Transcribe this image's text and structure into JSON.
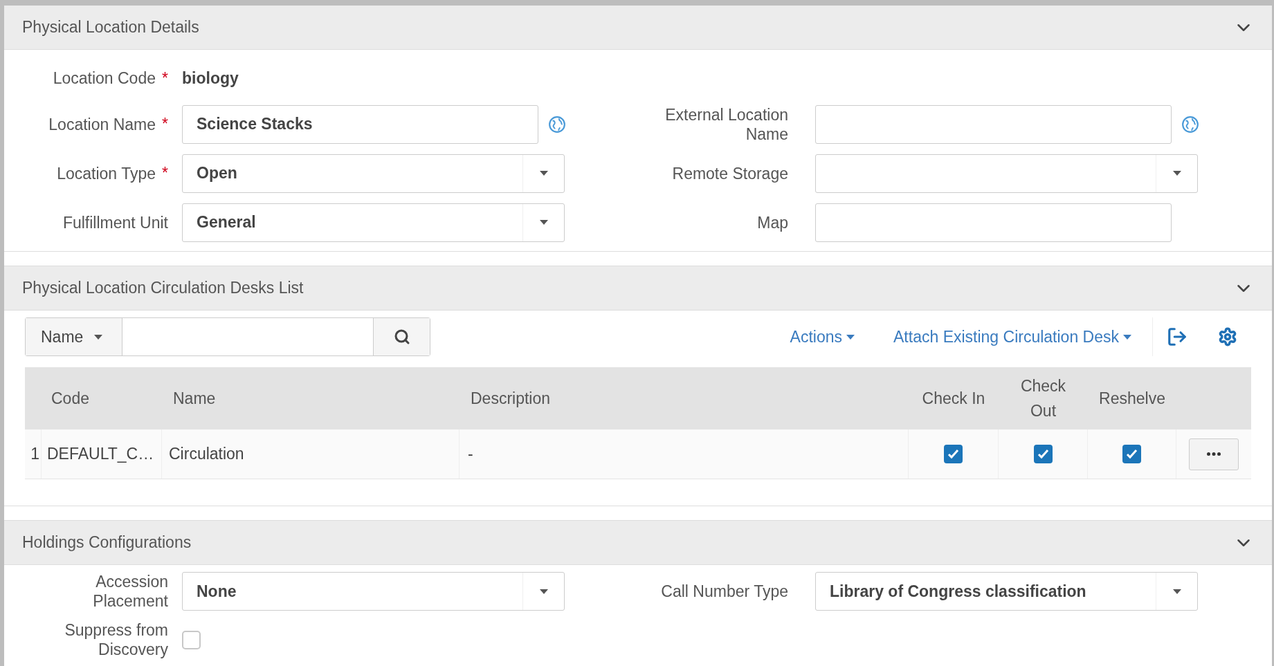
{
  "location_details": {
    "title": "Physical Location Details",
    "expanded": true,
    "rows": [
      {
        "left": {
          "label": "Location Code",
          "required_mark": "*",
          "kind": "static",
          "value": "biology"
        }
      },
      {
        "left": {
          "label": "Location Name",
          "required_mark": "*",
          "kind": "text",
          "value": "Science Stacks",
          "translatable": true
        },
        "right": {
          "label": "External Location Name",
          "kind": "text",
          "translatable": true
        }
      },
      {
        "left": {
          "label": "Location Type",
          "required_mark": "*",
          "kind": "select",
          "value": "Open"
        },
        "right": {
          "label": "Remote Storage",
          "kind": "select"
        }
      },
      {
        "left": {
          "label": "Fulfillment Unit",
          "kind": "select",
          "value": "General"
        },
        "right": {
          "label": "Map",
          "kind": "text"
        }
      }
    ]
  },
  "circulation_desks": {
    "title": "Physical Location Circulation Desks List",
    "expanded": true,
    "search": {
      "filter": "Name"
    },
    "actions": [
      {
        "label": "Actions"
      },
      {
        "label": "Attach Existing Circulation Desk"
      }
    ],
    "table": {
      "columns": [
        "Code",
        "Name",
        "Description",
        "Check In",
        "Check Out",
        "Reshelve"
      ],
      "rows": [
        {
          "number": "1",
          "code": "DEFAULT_C…",
          "name": "Circulation",
          "description": "-",
          "checks": [
            {
              "checked": true
            },
            {
              "checked": true
            },
            {
              "checked": true
            }
          ]
        }
      ]
    }
  },
  "holdings": {
    "title": "Holdings Configurations",
    "expanded": true,
    "rows": [
      {
        "left": {
          "label": "Accession Placement",
          "kind": "select",
          "value": "None"
        },
        "right": {
          "label": "Call Number Type",
          "kind": "select",
          "value": "Library of Congress classification"
        }
      },
      {
        "left": {
          "label": "Suppress from Discovery",
          "kind": "checkbox",
          "checked": false
        }
      }
    ]
  }
}
